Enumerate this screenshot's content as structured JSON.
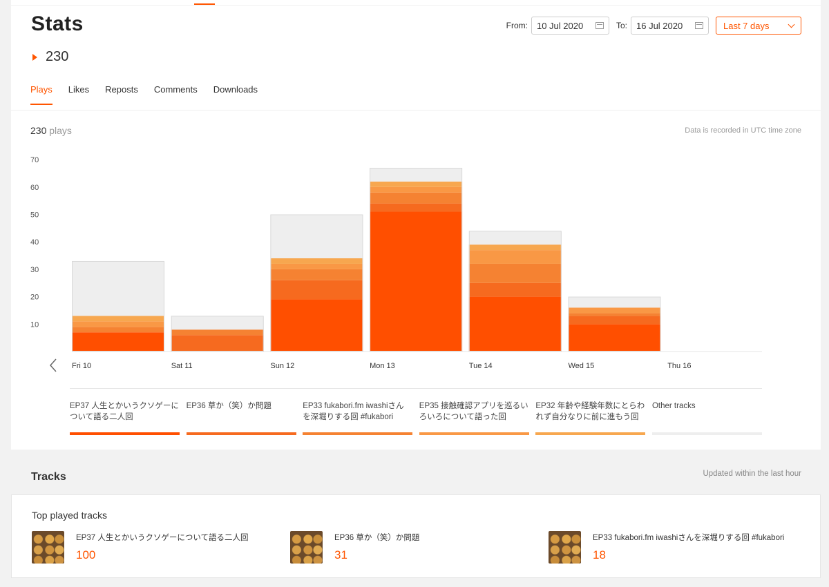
{
  "header": {
    "title": "Stats",
    "total": "230",
    "from_label": "From:",
    "from_value": "10 Jul 2020",
    "to_label": "To:",
    "to_value": "16 Jul 2020",
    "range_value": "Last 7 days"
  },
  "tabs": [
    {
      "label": "Plays",
      "active": true
    },
    {
      "label": "Likes",
      "active": false
    },
    {
      "label": "Reposts",
      "active": false
    },
    {
      "label": "Comments",
      "active": false
    },
    {
      "label": "Downloads",
      "active": false
    }
  ],
  "summary": {
    "count": "230",
    "unit": " plays",
    "note": "Data is recorded in UTC time zone"
  },
  "colors": {
    "accent": "#ff5500",
    "series": [
      "#ff4f00",
      "#f66a1f",
      "#f58232",
      "#f99845",
      "#f7a74f",
      "#eeeeee"
    ]
  },
  "chart_data": {
    "type": "bar",
    "stacked": true,
    "categories": [
      "Fri 10",
      "Sat 11",
      "Sun 12",
      "Mon 13",
      "Tue 14",
      "Wed 15",
      "Thu 16"
    ],
    "ylim": [
      0,
      70
    ],
    "yticks": [
      10,
      20,
      30,
      40,
      50,
      60,
      70
    ],
    "series": [
      {
        "name": "EP37 人生とかいうクソゲーについて語る二人回",
        "values": [
          7,
          0,
          19,
          51,
          20,
          10,
          0
        ]
      },
      {
        "name": "EP36 草か（笑）か問題",
        "values": [
          0,
          6,
          7,
          3,
          5,
          3,
          0
        ]
      },
      {
        "name": "EP33 fukabori.fm iwashiさんを深堀りする回 #fukabori",
        "values": [
          2,
          2,
          4,
          4,
          7,
          1,
          0
        ]
      },
      {
        "name": "EP35 接触確認アプリを巡るいろいろについて語った回",
        "values": [
          2,
          0,
          2,
          2,
          5,
          2,
          0
        ]
      },
      {
        "name": "EP32 年齢や経験年数にとらわれず自分なりに前に進もう回",
        "values": [
          2,
          0,
          2,
          2,
          2,
          0,
          0
        ]
      },
      {
        "name": "Other tracks",
        "values": [
          20,
          5,
          16,
          5,
          5,
          4,
          0
        ]
      }
    ]
  },
  "legend": [
    {
      "line1": "EP37 人生とかいうクソゲーに",
      "line2": "ついて語る二人回"
    },
    {
      "line1": "EP36 草か（笑）か問題",
      "line2": ""
    },
    {
      "line1": "EP33 fukabori.fm iwashiさん",
      "line2": "を深堀りする回 #fukabori"
    },
    {
      "line1": "EP35 接触確認アプリを巡るい",
      "line2": "ろいろについて語った回"
    },
    {
      "line1": "EP32 年齢や経験年数にとらわ",
      "line2": "れず自分なりに前に進もう回"
    },
    {
      "line1": "Other tracks",
      "line2": ""
    }
  ],
  "tracks": {
    "header": "Tracks",
    "updated": "Updated within the last hour",
    "top_label": "Top played tracks",
    "items": [
      {
        "title": "EP37 人生とかいうクソゲーについて語る二人回",
        "count": "100"
      },
      {
        "title": "EP36 草か（笑）か問題",
        "count": "31"
      },
      {
        "title": "EP33 fukabori.fm iwashiさんを深堀りする回 #fukabori",
        "count": "18"
      }
    ]
  }
}
